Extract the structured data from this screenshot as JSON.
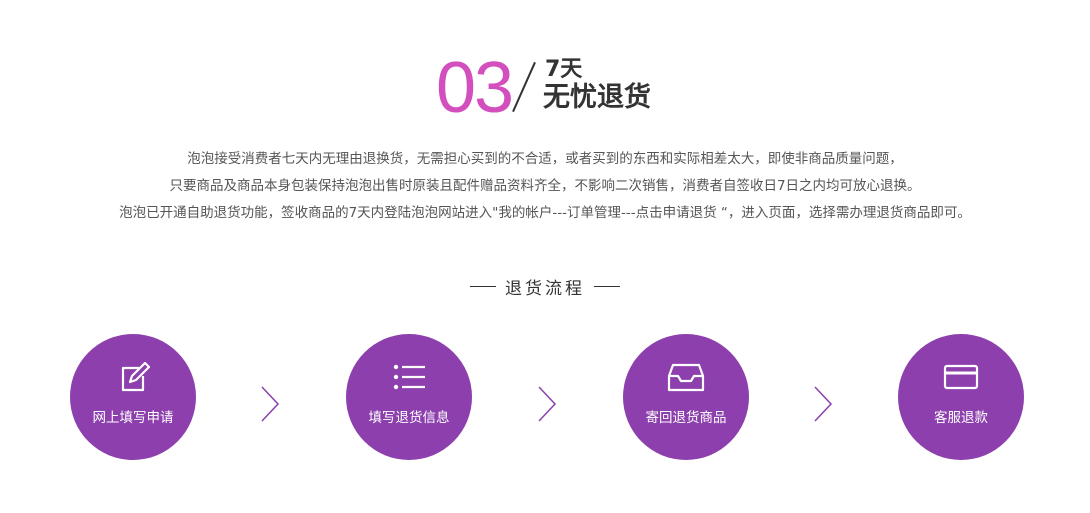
{
  "section": {
    "number": "03",
    "title_small": "7天",
    "title_big": "无忧退货"
  },
  "description": [
    "泡泡接受消费者七天内无理由退换货，无需担心买到的不合适，或者买到的东西和实际相差太大，即使非商品质量问题，",
    "只要商品及商品本身包装保持泡泡出售时原装且配件赠品资料齐全，不影响二次销售，消费者自签收日7日之内均可放心退换。",
    "泡泡已开通自助退货功能，签收商品的7天内登陆泡泡网站进入\"我的帐户---订单管理---点击申请退货 “，进入页面，选择需办理退货商品即可。"
  ],
  "flow": {
    "title": "退货流程",
    "steps": [
      {
        "label": "网上填写申请",
        "icon": "edit-icon"
      },
      {
        "label": "填写退货信息",
        "icon": "list-icon"
      },
      {
        "label": "寄回退货商品",
        "icon": "inbox-icon"
      },
      {
        "label": "客服退款",
        "icon": "card-icon"
      }
    ]
  },
  "colors": {
    "number": "#d24fbd",
    "circle": "#8c3fad",
    "arrow": "#8c3fad"
  }
}
